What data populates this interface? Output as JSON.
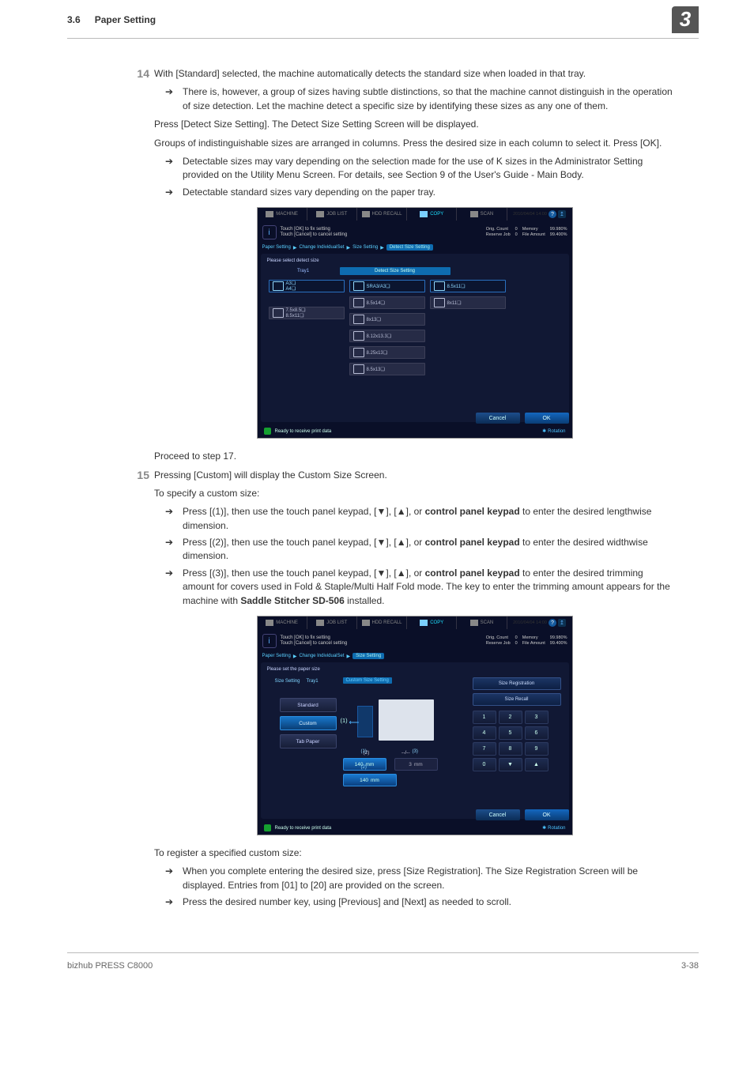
{
  "header": {
    "section": "3.6",
    "title": "Paper Setting",
    "chapter": "3"
  },
  "steps": {
    "s14": {
      "num": "14",
      "text": "With [Standard] selected, the machine automatically detects the standard size when loaded in that tray.",
      "bullet1": "There is, however, a group of sizes having subtle distinctions, so that the machine cannot distinguish in the operation of size detection. Let the machine detect a specific size by identifying these sizes as any one of them.",
      "para1": "Press [Detect Size Setting]. The Detect Size Setting Screen will be displayed.",
      "para2": "Groups of indistinguishable sizes are arranged in columns. Press the desired size in each column to select it. Press [OK].",
      "bullet2": "Detectable sizes may vary depending on the selection made for the use of K sizes in the Administrator Setting provided on the Utility Menu Screen. For details, see Section 9 of the User's Guide - Main Body.",
      "bullet3": "Detectable standard sizes vary depending on the paper tray."
    },
    "proceed": "Proceed to step 17.",
    "s15": {
      "num": "15",
      "text": "Pressing [Custom] will display the Custom Size Screen.",
      "para1": "To specify a custom size:",
      "bullet1a": "Press [(1)], then use the touch panel keypad, [",
      "trisym_dn": "▼",
      "bullet_mid": "], [",
      "trisym_up": "▲",
      "bullet1b": "], or ",
      "cp": "control panel keypad",
      "bullet1c": " to enter the desired lengthwise dimension.",
      "bullet2a": "Press [(2)], then use the touch panel keypad, [",
      "bullet2c": " to enter the desired widthwise dimension.",
      "bullet3a": "Press [(3)], then use the touch panel keypad, [",
      "bullet3c": " to enter the desired trimming amount for covers used in Fold & Staple/Multi Half Fold mode. The key to enter the trimming amount appears for the machine with ",
      "sd506": "Saddle Stitcher SD-506",
      "bullet3d": " installed.",
      "para_reg": "To register a specified custom size:",
      "bullet4": "When you complete entering the desired size, press [Size Registration]. The Size Registration Screen will be displayed. Entries from [01] to [20] are provided on the screen.",
      "bullet5": "Press the desired number key, using [Previous] and [Next] as needed to scroll."
    }
  },
  "arrow": "➔",
  "ss_common": {
    "tabs": [
      "MACHINE",
      "JOB LIST",
      "HDD RECALL",
      "COPY",
      "SCAN"
    ],
    "datetime": "2010/04/04 14:00",
    "info1": "Touch [OK] to fix setting",
    "info2": "Touch [Cancel] to cancel setting",
    "stats": {
      "l1": "Orig. Count",
      "l2": "Reserve Job",
      "v1": "0",
      "v2": "0",
      "r1": "Memory",
      "r2": "File Amount",
      "p1": "99.980%",
      "p2": "99.400%"
    },
    "crumb": {
      "c1": "Paper Setting",
      "c2": "Change IndividualSet",
      "c3": "Size Setting"
    },
    "cancel": "Cancel",
    "ok": "OK",
    "status": "Ready to receive print data",
    "rotation": "Rotation"
  },
  "ss1": {
    "crumb_hi": "Detect Size Setting",
    "panel_title": "Please select detect size",
    "col_header_left": "Tray1",
    "col_header_mid": "Detect Size Setting",
    "col1": [
      {
        "label": "A3❏\nA4❏",
        "sel": true
      },
      {
        "label": "7.5x8.5❏\n8.5x11❏",
        "sel": false
      }
    ],
    "col2": [
      {
        "label": "SRA3/A3❏",
        "sel": true
      },
      {
        "label": "8.5x14❏",
        "sel": false
      },
      {
        "label": "8x13❏",
        "sel": false
      },
      {
        "label": "8.12x13.3❏",
        "sel": false
      },
      {
        "label": "8.25x13❏",
        "sel": false
      },
      {
        "label": "8.5x13❏",
        "sel": false
      }
    ],
    "col3": [
      {
        "label": "8.5x11❏",
        "sel": true
      },
      {
        "label": "8x11❏",
        "sel": false
      }
    ]
  },
  "ss2": {
    "crumb_hi": "Size Setting",
    "panel_title": "Please set the paper size",
    "left_h1": "Size Setting",
    "left_h2": "Tray1",
    "left_btns": [
      {
        "label": "Standard",
        "sel": false
      },
      {
        "label": "Custom",
        "sel": true
      },
      {
        "label": "Tab Paper",
        "sel": false
      }
    ],
    "mid_h": "Custom Size Setting",
    "one1": "(1)",
    "one2": "(2)",
    "one3": "(3)",
    "d2": "--/--",
    "input1": "140",
    "input1u": "mm",
    "input2": "3",
    "input2u": "mm",
    "input3": "140",
    "input3u": "mm",
    "r1": "Size Registration",
    "r2": "Size Recall",
    "keys": [
      "1",
      "2",
      "3",
      "4",
      "5",
      "6",
      "7",
      "8",
      "9",
      "0",
      "▼",
      "▲"
    ]
  },
  "footer": {
    "left": "bizhub PRESS C8000",
    "right": "3-38"
  }
}
